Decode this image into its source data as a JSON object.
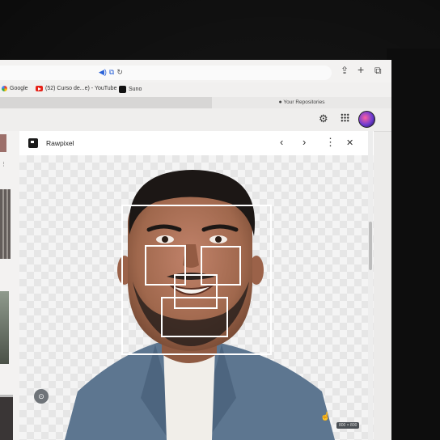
{
  "address_bar": {
    "icons": [
      "speaker-icon",
      "translate-icon",
      "reload-icon"
    ]
  },
  "toolbar": {
    "icons": [
      "share-icon",
      "new-tab-icon",
      "tabs-overview-icon"
    ]
  },
  "bookmarks": [
    {
      "icon": "google-icon",
      "label": "Google"
    },
    {
      "icon": "youtube-icon",
      "label": "(52) Curso de...e) - YouTube"
    },
    {
      "icon": "suno-icon",
      "label": "Suno"
    }
  ],
  "tabs": {
    "repositories": "Your Repositories"
  },
  "page_header": {
    "icons": [
      "gear-icon",
      "apps-grid-icon",
      "avatar"
    ]
  },
  "panel": {
    "title": "Rawpixel",
    "prev": "‹",
    "next": "›",
    "more": "⋮",
    "close": "✕",
    "image_size": "800 × 800"
  },
  "detections": {
    "labels": [
      "face",
      "left-eye",
      "right-eye",
      "nose",
      "mouth"
    ]
  },
  "colors": {
    "box_stroke": "#ffffff",
    "jacket": "#5d7690",
    "skin": "#a0684d"
  }
}
